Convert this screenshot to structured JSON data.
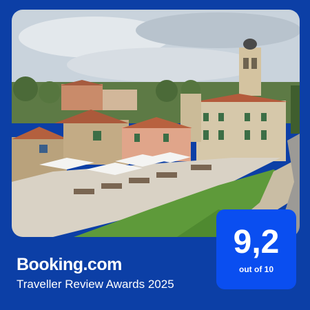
{
  "brand": {
    "name": "Booking.com"
  },
  "award": {
    "title": "Traveller Review Awards 2025"
  },
  "rating": {
    "score": "9,2",
    "scale": "out of 10"
  },
  "colors": {
    "background": "#0c3fa6",
    "badge": "#0a4ef0",
    "text": "#ffffff"
  },
  "photo": {
    "subject": "hotel-courtyard-photo"
  }
}
